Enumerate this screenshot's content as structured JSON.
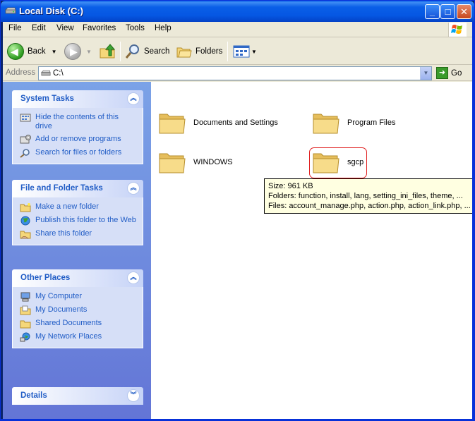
{
  "window": {
    "title": "Local Disk (C:)"
  },
  "menubar": {
    "items": [
      "File",
      "Edit",
      "View",
      "Favorites",
      "Tools",
      "Help"
    ]
  },
  "toolbar": {
    "back_label": "Back",
    "search_label": "Search",
    "folders_label": "Folders"
  },
  "address": {
    "label": "Address",
    "value": "C:\\",
    "go_label": "Go"
  },
  "taskpane": {
    "system_tasks": {
      "title": "System Tasks",
      "items": [
        {
          "label": "Hide the contents of this drive",
          "icon": "hide-contents-icon"
        },
        {
          "label": "Add or remove programs",
          "icon": "add-remove-programs-icon"
        },
        {
          "label": "Search for files or folders",
          "icon": "search-icon"
        }
      ]
    },
    "file_folder_tasks": {
      "title": "File and Folder Tasks",
      "items": [
        {
          "label": "Make a new folder",
          "icon": "new-folder-icon"
        },
        {
          "label": "Publish this folder to the Web",
          "icon": "globe-icon"
        },
        {
          "label": "Share this folder",
          "icon": "share-folder-icon"
        }
      ]
    },
    "other_places": {
      "title": "Other Places",
      "items": [
        {
          "label": "My Computer",
          "icon": "computer-icon"
        },
        {
          "label": "My Documents",
          "icon": "documents-icon"
        },
        {
          "label": "Shared Documents",
          "icon": "shared-folder-icon"
        },
        {
          "label": "My Network Places",
          "icon": "network-icon"
        }
      ]
    },
    "details": {
      "title": "Details"
    }
  },
  "files": [
    {
      "name": "Documents and Settings"
    },
    {
      "name": "Program Files"
    },
    {
      "name": "WINDOWS"
    },
    {
      "name": "sgcp"
    }
  ],
  "tooltip": {
    "size": "Size: 961 KB",
    "folders": "Folders: function, install, lang, setting_ini_files, theme, ...",
    "files": "Files: account_manage.php, action.php, action_link.php, ..."
  },
  "colors": {
    "titlebar": "#0a5fe7",
    "taskpane_bg": "#6375d6",
    "link_blue": "#215dc6",
    "folder_yellow": "#f5d77a",
    "highlight_red": "#e02020"
  }
}
